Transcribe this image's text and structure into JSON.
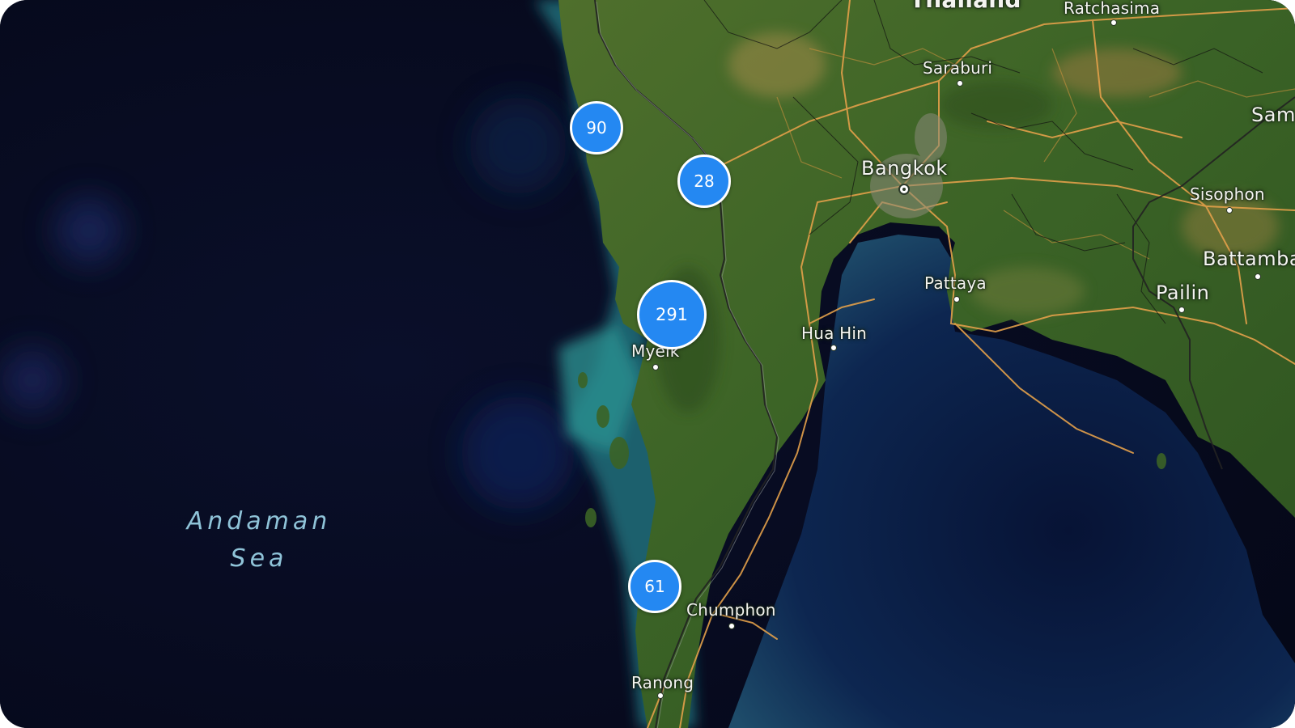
{
  "map": {
    "style": "satellite-hybrid",
    "sea_labels": [
      {
        "id": "andaman-sea",
        "lines": [
          "Andaman",
          "Sea"
        ]
      }
    ],
    "country_labels": [
      {
        "id": "thailand",
        "text": "Thailand",
        "partially_visible": true
      }
    ],
    "places": [
      {
        "id": "nakhon-ratchasima",
        "text": "Ratchasima",
        "partially_visible": true
      },
      {
        "id": "saraburi",
        "text": "Saraburi"
      },
      {
        "id": "bangkok",
        "text": "Bangkok",
        "capital": true
      },
      {
        "id": "sisophon",
        "text": "Sisophon"
      },
      {
        "id": "sam",
        "text": "Sam",
        "partially_visible": true
      },
      {
        "id": "battambang",
        "text": "Battamba",
        "partially_visible": true
      },
      {
        "id": "pailin",
        "text": "Pailin"
      },
      {
        "id": "pattaya",
        "text": "Pattaya"
      },
      {
        "id": "hua-hin",
        "text": "Hua Hin"
      },
      {
        "id": "myeik",
        "text": "Myeik"
      },
      {
        "id": "chumphon",
        "text": "Chumphon"
      },
      {
        "id": "ranong",
        "text": "Ranong"
      }
    ],
    "clusters": [
      {
        "id": "cluster-90",
        "count": "90"
      },
      {
        "id": "cluster-28",
        "count": "28"
      },
      {
        "id": "cluster-291",
        "count": "291"
      },
      {
        "id": "cluster-61",
        "count": "61"
      }
    ],
    "colors": {
      "cluster_fill": "#2488f2",
      "cluster_border": "#ffffff",
      "ocean_deep": "#070b1e",
      "ocean_shallow": "#2b8f95",
      "land": "#3f6a2a",
      "roads": "#e3a04a",
      "borders": "#1a1a1a"
    }
  }
}
